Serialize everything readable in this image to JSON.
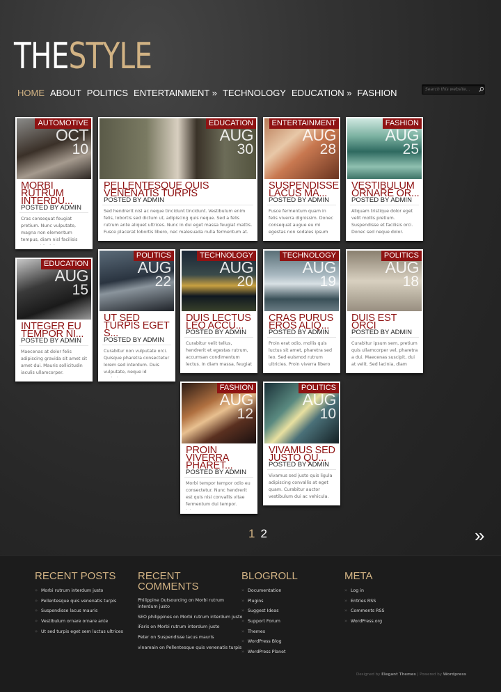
{
  "logo": {
    "part1": "THE",
    "part2": "ST",
    "part3": "Y",
    "part4": "LE"
  },
  "nav": {
    "home": "HOME",
    "about": "ABOUT",
    "politics": "POLITICS",
    "entertainment": "ENTERTAINMENT »",
    "technology": "TECHNOLOGY",
    "education": "EDUCATION »",
    "fashion": "FASHION"
  },
  "search": {
    "placeholder": "Search this website..."
  },
  "posts": [
    {
      "category": "AUTOMOTIVE",
      "month": "OCT",
      "day": "10",
      "title": "MORBI RUTRUM INTERDU...",
      "byline": "POSTED BY ADMIN",
      "excerpt": "Cras consequat feugiat pretium. Nunc vulputate, magna non elementum tempus, diam nisl facilisis augue, ut lacinia quam"
    },
    {
      "category": "EDUCATION",
      "month": "AUG",
      "day": "30",
      "title": "PELLENTESQUE QUIS VENENATIS TURPIS",
      "byline": "POSTED BY ADMIN",
      "excerpt": "Sed hendrerit nisl ac neque tincidunt tincidunt. Vestibulum enim felis, lobortis sed dictum ut, adipiscing quis neque. Sed a felis rutrum ante aliquet ultrices. Nunc in dui eget massa feugiat mattis. Fusce placerat lobortis libero, nec malesuada nulla fermentum at. Nulla ligula enim, tincidunt interdum euismod sed,"
    },
    {
      "category": "ENTERTAINMENT",
      "month": "AUG",
      "day": "28",
      "title": "SUSPENDISSE LACUS MA...",
      "byline": "POSTED BY ADMIN",
      "excerpt": "Fusce fermentum quam in felis viverra dignissim. Donec consequat augue eu mi egestas non sodales ipsum scelerisque."
    },
    {
      "category": "FASHION",
      "month": "AUG",
      "day": "25",
      "title": "VESTIBULUM ORNARE OR...",
      "byline": "POSTED BY ADMIN",
      "excerpt": "Aliquam tristique dolor eget velit mollis pretium. Suspendisse et facilisis orci. Donec sed neque dolor. Aenean non elit lacus"
    },
    {
      "category": "EDUCATION",
      "month": "AUG",
      "day": "15",
      "title": "INTEGER EU TEMPOR NI...",
      "byline": "POSTED BY ADMIN",
      "excerpt": "Maecenas at dolor felis adipiscing gravida sit amet sit amet dui. Mauris sollicitudin iaculis ullamcorper."
    },
    {
      "category": "POLITICS",
      "month": "AUG",
      "day": "22",
      "title": "UT SED TURPIS EGET S...",
      "byline": "POSTED BY ADMIN",
      "excerpt": "Curabitur non vulputate orci. Quisque pharetra consectetur lorem sed interdum. Duis vulputate, neque id scelerisque"
    },
    {
      "category": "TECHNOLOGY",
      "month": "AUG",
      "day": "20",
      "title": "DUIS LECTUS LEO ACCU...",
      "byline": "POSTED BY ADMIN",
      "excerpt": "Curabitur velit tellus, hendrerit et egestas rutrum, accumsan condimentum lectus. In diam massa, feugiat mattis tincidunt"
    },
    {
      "category": "TECHNOLOGY",
      "month": "AUG",
      "day": "19",
      "title": "CRAS PURUS EROS ALIQ...",
      "byline": "POSTED BY ADMIN",
      "excerpt": "Proin erat odio, mollis quis luctus sit amet, pharetra sed leo. Sed euismod rutrum ultricies. Proin viverra libero sed turpis"
    },
    {
      "category": "POLITICS",
      "month": "AUG",
      "day": "18",
      "title": "DUIS EST ORCI",
      "byline": "POSTED BY ADMIN",
      "excerpt": "Curabitur ipsum sem, pretium quis ullamcorper vel, pharetra a dui. Maecenas suscipit, dui at velit. Sed lacinia, diam laoreet fermentum at ipsum tortor, quam velit"
    },
    {
      "category": "FASHION",
      "month": "AUG",
      "day": "12",
      "title": "PROIN VIVERRA PHARET...",
      "byline": "POSTED BY ADMIN",
      "excerpt": "Morbi tempor tempor odio eu consectetur. Nunc hendrerit est quis nisi convallis vitae fermentum dui tempor. Integer"
    },
    {
      "category": "POLITICS",
      "month": "AUG",
      "day": "10",
      "title": "VIVAMUS SED JUSTO QU...",
      "byline": "POSTED BY ADMIN",
      "excerpt": "Vivamus sed justo quis ligula adipiscing convallis at eget quam. Curabitur auctor vestibulum dui ac vehicula."
    }
  ],
  "pagination": {
    "page1": "1",
    "page2": "2",
    "next": "»"
  },
  "footer": {
    "recent_posts": {
      "heading": "RECENT POSTS",
      "items": [
        "Morbi rutrum interdum justo",
        "Pellentesque quis venenatis turpis",
        "Suspendisse lacus mauris",
        "Vestibulum ornare ornare ante",
        "Ut sed turpis eget sem luctus ultrices"
      ]
    },
    "recent_comments": {
      "heading_line1": "RECENT",
      "heading_line2": "COMMENTS",
      "items": [
        "Philippine Outsourcing on Morbi rutrum",
        "interdum justo",
        "SEO philippines on Morbi rutrum interdum justo",
        "iFaris on Morbi rutrum interdum justo",
        "Peter on Suspendisse lacus mauris",
        "vinamain on Pellentesque quis venenatis turpis"
      ]
    },
    "blogroll": {
      "heading": "BLOGROLL",
      "items": [
        "Documentation",
        "Plugins",
        "Suggest Ideas",
        "Support Forum",
        "Themes",
        "WordPress Blog",
        "WordPress Planet"
      ]
    },
    "meta": {
      "heading": "META",
      "items": [
        "Log in",
        "Entries RSS",
        "Comments RSS",
        "WordPress.org"
      ]
    },
    "credit": {
      "designed": "Designed by",
      "elegant": "Elegant Themes",
      "sep": " | Powered by ",
      "wordpress": "Wordpress"
    }
  },
  "colors": {
    "accent": "#8f1313",
    "gold": "#d2b384"
  },
  "icons": {
    "search": "search-icon",
    "next": "double-chevron-icon"
  }
}
